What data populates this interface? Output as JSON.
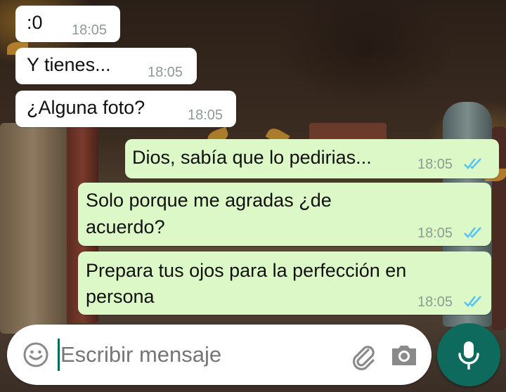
{
  "theme": {
    "incoming_bg": "#ffffff",
    "outgoing_bg": "#dcf8c6",
    "read_tick_color": "#4fc3f7",
    "accent": "#0e6a5c"
  },
  "messages": [
    {
      "direction": "incoming",
      "text": ":0",
      "time": "18:05"
    },
    {
      "direction": "incoming",
      "text": "Y tienes...",
      "time": "18:05"
    },
    {
      "direction": "incoming",
      "text": "¿Alguna foto?",
      "time": "18:05"
    },
    {
      "direction": "outgoing",
      "text": "Dios, sabía que lo pedirias...",
      "time": "18:05",
      "status": "read"
    },
    {
      "direction": "outgoing",
      "lines": [
        "Solo porque me agradas ¿de",
        "acuerdo?"
      ],
      "time": "18:05",
      "status": "read"
    },
    {
      "direction": "outgoing",
      "lines": [
        "Prepara tus ojos para la perfección en",
        "persona"
      ],
      "time": "18:05",
      "status": "read"
    }
  ],
  "composer": {
    "placeholder": "Escribir mensaje",
    "icons": [
      "emoji-icon",
      "paperclip-icon",
      "camera-icon",
      "microphone-icon"
    ]
  }
}
